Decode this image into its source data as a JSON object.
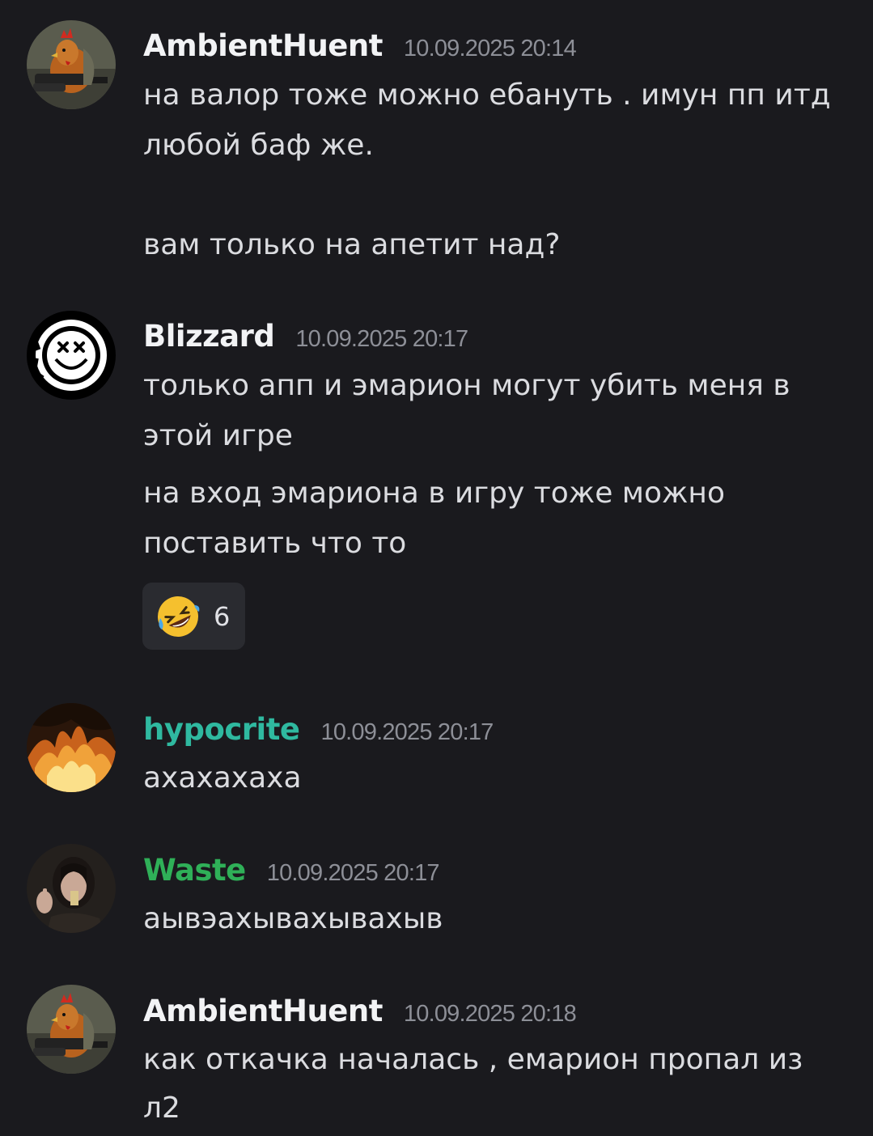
{
  "colors": {
    "background": "#1a1a1e",
    "username_default": "#f2f3f5",
    "username_hypocrite": "#2fb9a0",
    "username_waste": "#2fb058",
    "timestamp": "#8d8f97",
    "message_text": "#dbdce0",
    "reaction_bg": "#2a2b30"
  },
  "messages": [
    {
      "author": "AmbientHuent",
      "timestamp": "10.09.2025 20:14",
      "avatar_icon": "rooster-with-gun-avatar",
      "lines": [
        "на валор тоже можно ебануть . имун пп итд",
        "любой баф же.",
        "вам только на апетит над?"
      ]
    },
    {
      "author": "Blizzard",
      "timestamp": "10.09.2025 20:17",
      "avatar_icon": "smiley-logo-avatar",
      "lines": [
        "только апп и эмарион могут убить меня в",
        "этой игре",
        "на вход эмариона в игру тоже можно",
        "поставить что то"
      ],
      "reaction": {
        "emoji": "rolling-on-floor-laughing-emoji",
        "count": "6"
      }
    },
    {
      "author": "hypocrite",
      "timestamp": "10.09.2025 20:17",
      "avatar_icon": "fire-avatar",
      "lines": [
        "ахахахаха"
      ]
    },
    {
      "author": "Waste",
      "timestamp": "10.09.2025 20:17",
      "avatar_icon": "girl-photo-avatar",
      "lines": [
        "аывэахывахывахыв"
      ]
    },
    {
      "author": "AmbientHuent",
      "timestamp": "10.09.2025 20:18",
      "avatar_icon": "rooster-with-gun-avatar",
      "lines": [
        "как откачка началась , емарион пропал из",
        "л2"
      ]
    }
  ]
}
